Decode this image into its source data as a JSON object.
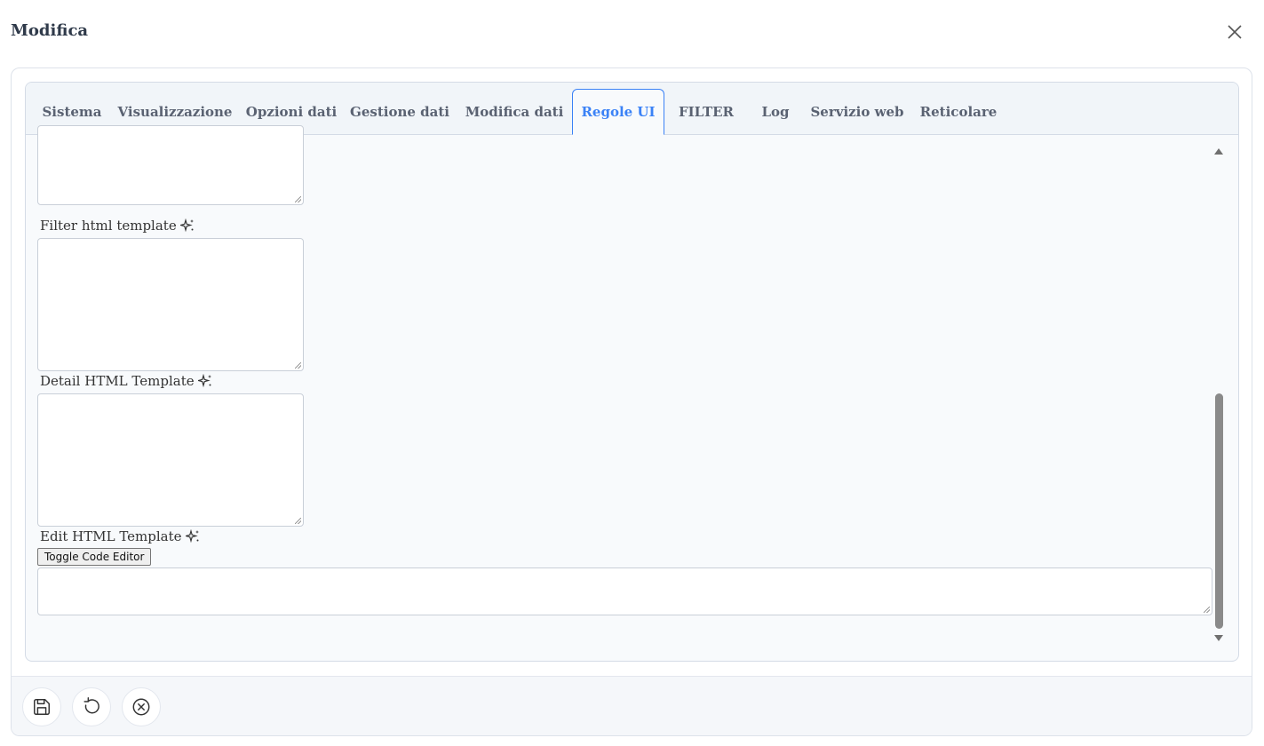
{
  "dialog": {
    "title": "Modifica",
    "close_icon": "close-icon"
  },
  "tabs": [
    {
      "label": "Sistema",
      "active": false
    },
    {
      "label": "Visualizzazione",
      "active": false
    },
    {
      "label": "Opzioni dati",
      "active": false
    },
    {
      "label": "Gestione dati",
      "active": false
    },
    {
      "label": "Modifica dati",
      "active": false
    },
    {
      "label": "Regole UI",
      "active": true
    },
    {
      "label": "FILTER",
      "active": false
    },
    {
      "label": "Log",
      "active": false
    },
    {
      "label": "Servizio web",
      "active": false
    },
    {
      "label": "Reticolare",
      "active": false
    }
  ],
  "fields": {
    "filter_html_template": {
      "label": "Filter html template",
      "value": ""
    },
    "detail_html_template": {
      "label": "Detail HTML Template",
      "value": ""
    },
    "edit_html_template": {
      "label": "Edit HTML Template",
      "value": ""
    },
    "toggle_code_editor": "Toggle Code Editor"
  },
  "footer": {
    "buttons": [
      {
        "icon": "save-icon"
      },
      {
        "icon": "undo-icon"
      },
      {
        "icon": "cancel-circle-icon"
      }
    ]
  },
  "colors": {
    "accent": "#3b82f6",
    "tab_text": "#5a6272",
    "title": "#2f3a4a"
  }
}
